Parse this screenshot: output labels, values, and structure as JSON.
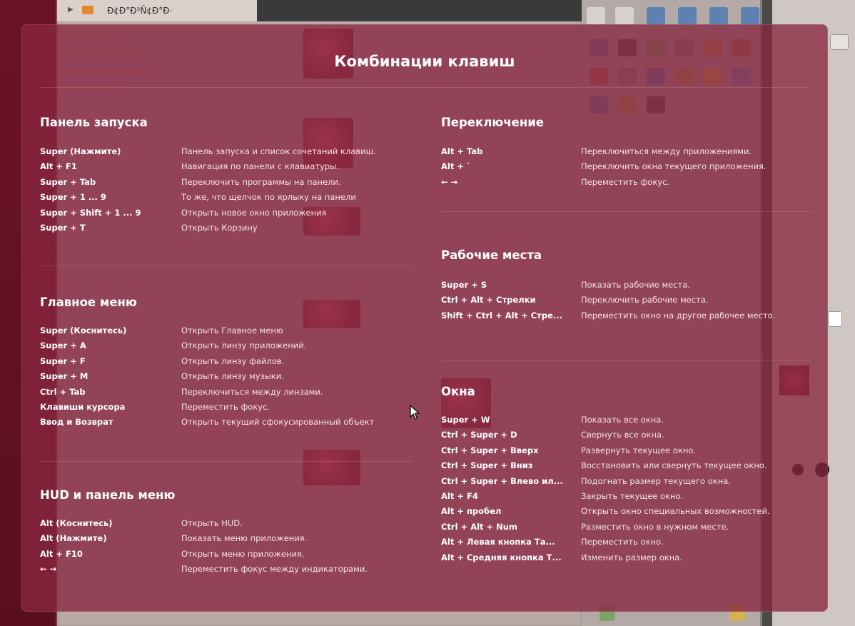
{
  "background": {
    "topbar_path": "Ð¢Ð°Ð³Ñ¢Ð°Ð·",
    "accent_color": "#882640"
  },
  "dialog": {
    "title": "Комбинации клавиш",
    "sections": [
      {
        "title": "Панель запуска",
        "rows": [
          {
            "key": "Super (Нажмите)",
            "desc": "Панель запуска и список сочетаний клавиш."
          },
          {
            "key": "Alt + F1",
            "desc": "Навигация по панели с клавиатуры."
          },
          {
            "key": "Super + Tab",
            "desc": "Переключить программы на панели."
          },
          {
            "key": "Super + 1 ... 9",
            "desc": "То же, что щелчок по ярлыку на панели"
          },
          {
            "key": "Super + Shift + 1 ... 9",
            "desc": "Открыть новое окно приложения"
          },
          {
            "key": "Super + T",
            "desc": "Открыть Корзину"
          }
        ]
      },
      {
        "title": "Главное меню",
        "rows": [
          {
            "key": "Super (Коснитесь)",
            "desc": "Открыть Главное меню"
          },
          {
            "key": "Super + A",
            "desc": "Открыть линзу приложений."
          },
          {
            "key": "Super + F",
            "desc": "Открыть линзу файлов."
          },
          {
            "key": "Super + M",
            "desc": "Открыть линзу музыки."
          },
          {
            "key": "Ctrl + Tab",
            "desc": "Переключиться между линзами."
          },
          {
            "key": "Клавиши курсора",
            "desc": "Переместить фокус."
          },
          {
            "key": "Ввод и Возврат",
            "desc": "Открыть текущий сфокусированный объект"
          }
        ]
      },
      {
        "title": "HUD и панель меню",
        "rows": [
          {
            "key": "Alt (Коснитесь)",
            "desc": "Открыть HUD."
          },
          {
            "key": "Alt (Нажмите)",
            "desc": "Показать меню приложения."
          },
          {
            "key": "Alt + F10",
            "desc": "Открыть меню приложения."
          },
          {
            "key": "← →",
            "desc": "Переместить фокус между индикаторами."
          }
        ]
      },
      {
        "title": "Переключение",
        "rows": [
          {
            "key": "Alt + Tab",
            "desc": "Переключиться между приложениями."
          },
          {
            "key": "Alt + `",
            "desc": "Переключить окна текущего приложения."
          },
          {
            "key": "← →",
            "desc": "Переместить фокус."
          }
        ]
      },
      {
        "title": "Рабочие места",
        "rows": [
          {
            "key": "Super + S",
            "desc": "Показать рабочие места."
          },
          {
            "key": "Ctrl + Alt + Стрелки",
            "desc": "Переключить рабочие места."
          },
          {
            "key": "Shift + Ctrl + Alt + Стре...",
            "desc": "Переместить окно на другое рабочее место."
          }
        ]
      },
      {
        "title": "Окна",
        "rows": [
          {
            "key": "Super + W",
            "desc": "Показать все окна."
          },
          {
            "key": "Ctrl + Super + D",
            "desc": "Свернуть все окна."
          },
          {
            "key": "Ctrl + Super + Вверх",
            "desc": "Развернуть текущее окно."
          },
          {
            "key": "Ctrl + Super + Вниз",
            "desc": "Восстановить или свернуть текущее окно."
          },
          {
            "key": "Ctrl + Super + Влево ил...",
            "desc": "Подогнать размер текущего окна."
          },
          {
            "key": "Alt + F4",
            "desc": "Закрыть текущее окно."
          },
          {
            "key": "Alt + пробел",
            "desc": "Открыть окно специальных возможностей."
          },
          {
            "key": "Ctrl + Alt + Num",
            "desc": "Разместить окно в нужном месте."
          },
          {
            "key": "Alt + Левая кнопка Та...",
            "desc": "Переместить окно."
          },
          {
            "key": "Alt + Средняя кнопка Т...",
            "desc": "Изменить размер окна."
          }
        ]
      }
    ]
  }
}
